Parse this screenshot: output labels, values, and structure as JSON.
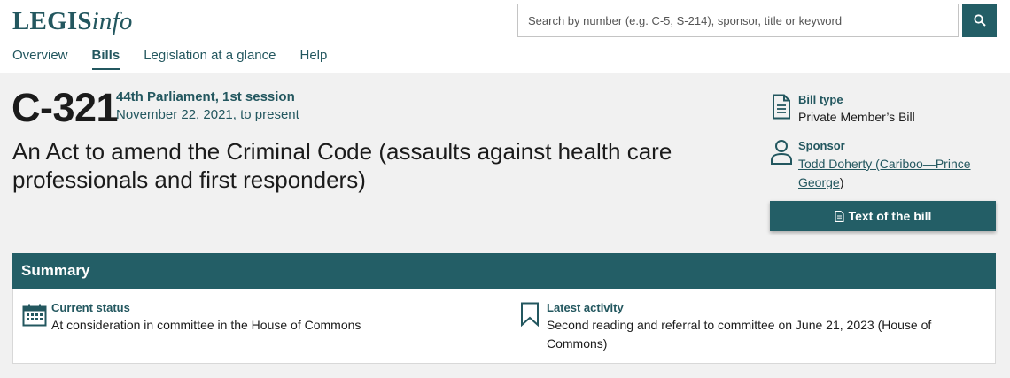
{
  "logo": {
    "strong": "LEGIS",
    "italic": "info"
  },
  "search": {
    "placeholder": "Search by number (e.g. C-5, S-214), sponsor, title or keyword",
    "button_icon": "search-icon"
  },
  "nav": [
    {
      "label": "Overview",
      "active": false
    },
    {
      "label": "Bills",
      "active": true
    },
    {
      "label": "Legislation at a glance",
      "active": false
    },
    {
      "label": "Help",
      "active": false
    }
  ],
  "bill": {
    "number": "C-321",
    "parliament": "44th Parliament, 1st session",
    "dates": "November 22, 2021, to present",
    "title": "An Act to amend the Criminal Code (assaults against health care professionals and first responders)"
  },
  "sidebar": {
    "bill_type_label": "Bill type",
    "bill_type_value": "Private Member’s Bill",
    "sponsor_label": "Sponsor",
    "sponsor_link": "Todd Doherty (Cariboo—Prince George",
    "sponsor_suffix": ")",
    "text_button": "Text of the bill"
  },
  "summary": {
    "heading": "Summary",
    "current_status_label": "Current status",
    "current_status_value": "At consideration in committee in the House of Commons",
    "latest_activity_label": "Latest activity",
    "latest_activity_value": "Second reading and referral to committee on June 21, 2023 (House of Commons)"
  },
  "colors": {
    "accent": "#235e66",
    "page_bg": "#f1f1f1"
  }
}
